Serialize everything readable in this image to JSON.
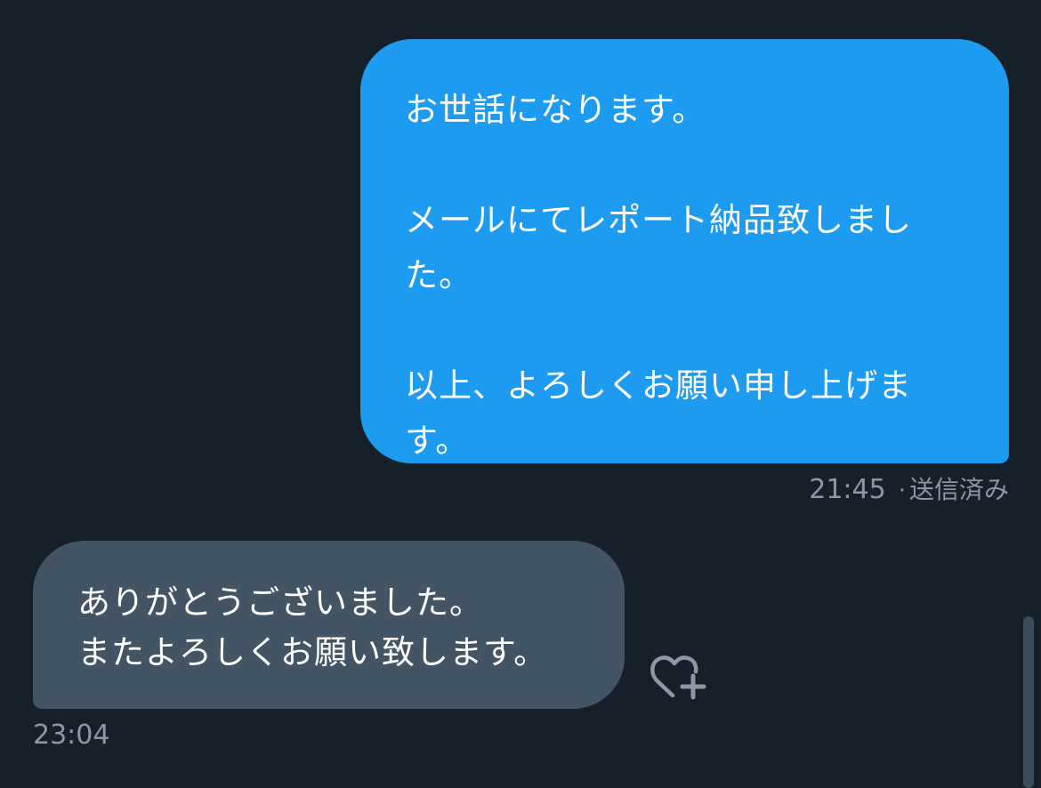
{
  "messages": {
    "sent": {
      "text": "お世話になります。\n\nメールにてレポート納品致しました。\n\n以上、よろしくお願い申し上げます。",
      "time": "21:45",
      "separator": "·",
      "status": "送信済み"
    },
    "received": {
      "text": "ありがとうございました。\nまたよろしくお願い致します。",
      "time": "23:04"
    }
  },
  "icons": {
    "react": "heart-plus-icon"
  },
  "colors": {
    "background": "#15202b",
    "sent_bubble": "#1d9bf0",
    "received_bubble": "#435564",
    "meta_text": "#8b98a5"
  }
}
